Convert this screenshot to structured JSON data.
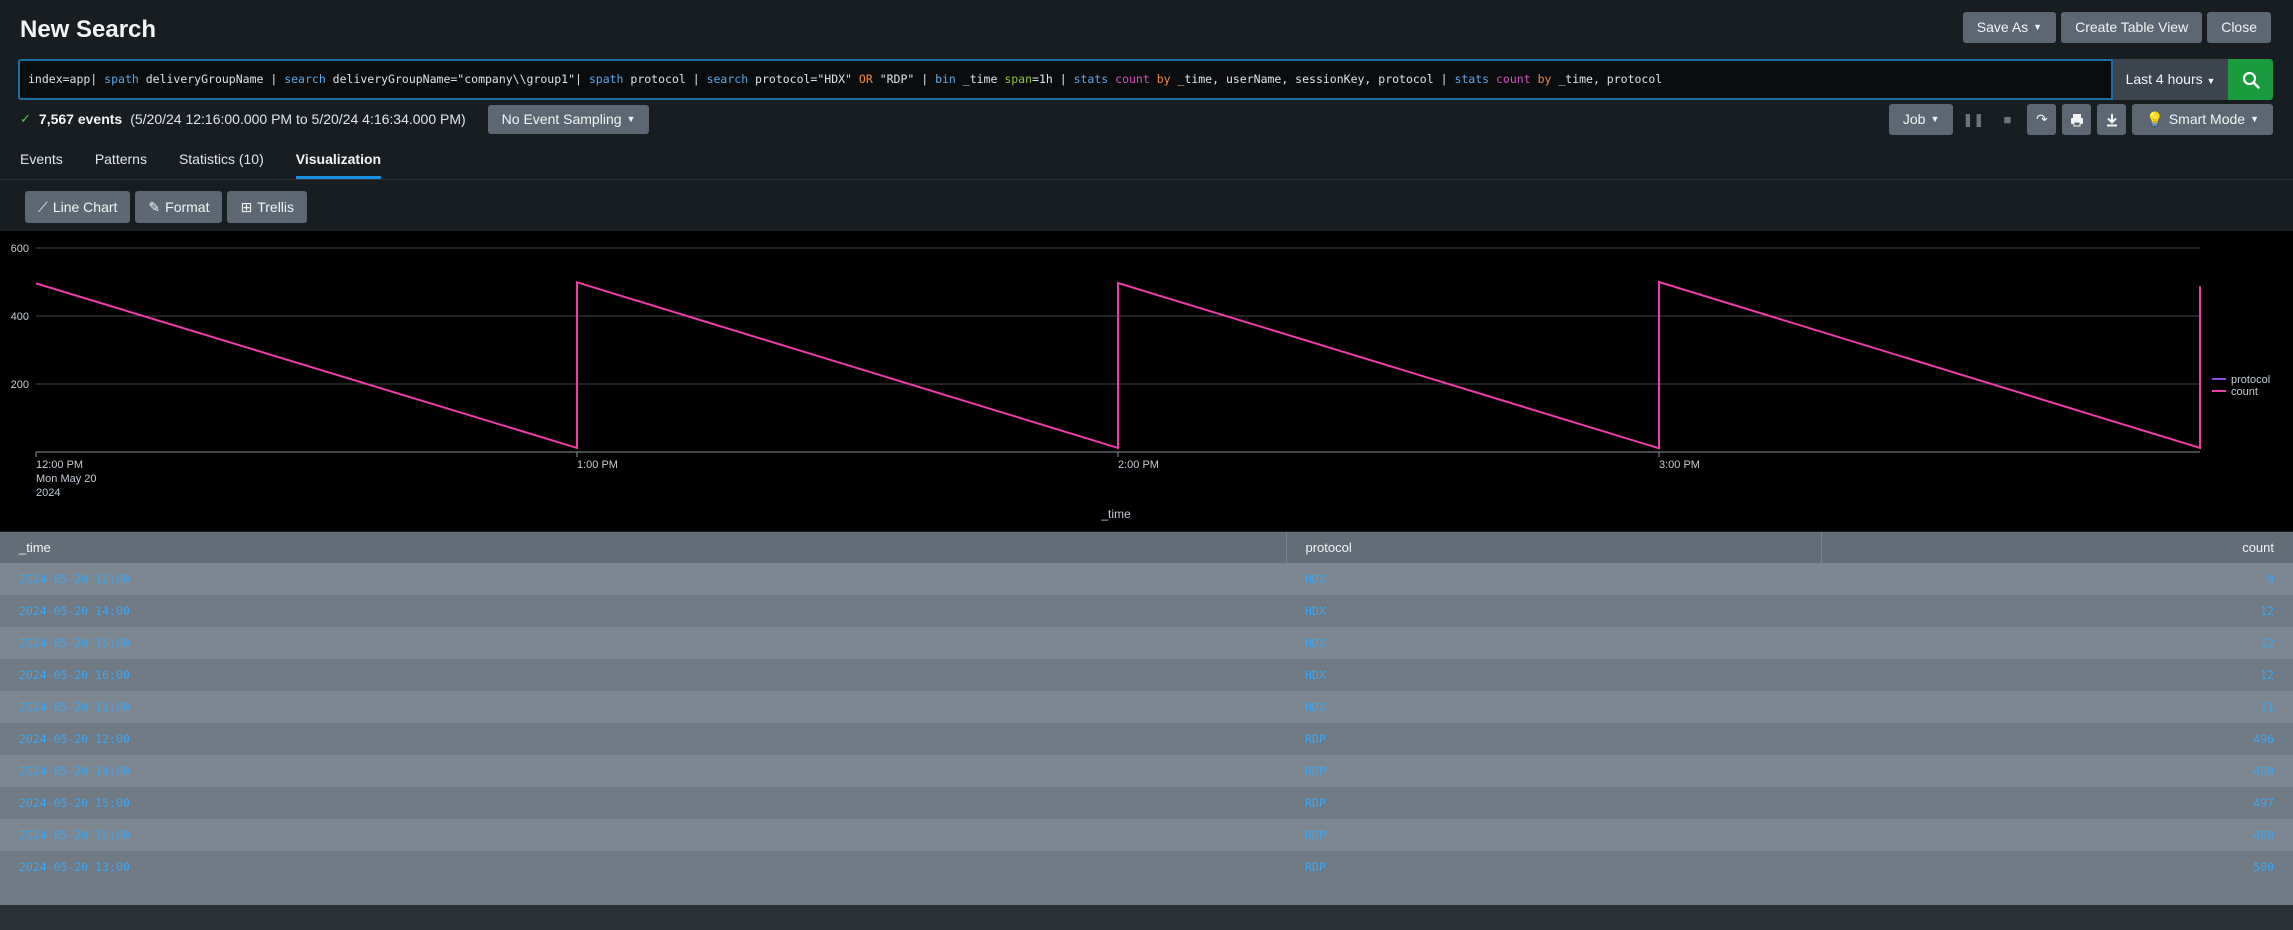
{
  "header": {
    "title": "New Search",
    "save_as": "Save As",
    "create_table_view": "Create Table View",
    "close": "Close"
  },
  "search": {
    "tokens": [
      {
        "t": "index=app| ",
        "c": ""
      },
      {
        "t": "spath",
        "c": "kw"
      },
      {
        "t": " deliveryGroupName | ",
        "c": ""
      },
      {
        "t": "search",
        "c": "kw"
      },
      {
        "t": " deliveryGroupName=\"company\\\\group1\"| ",
        "c": ""
      },
      {
        "t": "spath",
        "c": "kw"
      },
      {
        "t": " protocol | ",
        "c": ""
      },
      {
        "t": "search",
        "c": "kw"
      },
      {
        "t": " protocol=\"HDX\" ",
        "c": ""
      },
      {
        "t": "OR",
        "c": "op"
      },
      {
        "t": " \"RDP\" | ",
        "c": ""
      },
      {
        "t": "bin",
        "c": "kw"
      },
      {
        "t": " _time ",
        "c": ""
      },
      {
        "t": "span",
        "c": "arg"
      },
      {
        "t": "=1h | ",
        "c": ""
      },
      {
        "t": "stats",
        "c": "kw"
      },
      {
        "t": " ",
        "c": ""
      },
      {
        "t": "count",
        "c": "fn"
      },
      {
        "t": " ",
        "c": ""
      },
      {
        "t": "by",
        "c": "op"
      },
      {
        "t": " _time, userName, sessionKey, protocol | ",
        "c": ""
      },
      {
        "t": "stats",
        "c": "kw"
      },
      {
        "t": " ",
        "c": ""
      },
      {
        "t": "count",
        "c": "fn"
      },
      {
        "t": " ",
        "c": ""
      },
      {
        "t": "by",
        "c": "op"
      },
      {
        "t": " _time, protocol",
        "c": ""
      }
    ],
    "time_range": "Last 4 hours"
  },
  "status": {
    "events": "7,567 events",
    "range": "(5/20/24 12:16:00.000 PM to 5/20/24 4:16:34.000 PM)",
    "sampling": "No Event Sampling",
    "job": "Job",
    "mode": "Smart Mode"
  },
  "tabs": [
    {
      "label": "Events"
    },
    {
      "label": "Patterns"
    },
    {
      "label": "Statistics (10)"
    },
    {
      "label": "Visualization"
    }
  ],
  "viz_toolbar": {
    "line_chart": "Line Chart",
    "format": "Format",
    "trellis": "Trellis"
  },
  "chart_data": {
    "type": "line",
    "xlabel": "_time",
    "ylim": [
      0,
      600
    ],
    "y_ticks": [
      600,
      400,
      200
    ],
    "x_ticks": [
      "12:00 PM",
      "1:00 PM",
      "2:00 PM",
      "3:00 PM"
    ],
    "x_subtitle": [
      "Mon May 20",
      "2024"
    ],
    "grid": true,
    "legend_position": "right",
    "series": [
      {
        "name": "protocol",
        "color": "#8a4fd9",
        "x": [],
        "y": []
      },
      {
        "name": "count",
        "color": "#ee3ca8",
        "x": [
          0,
          1,
          1,
          2,
          2,
          3,
          3,
          4,
          4
        ],
        "y": [
          496,
          12,
          499,
          12,
          497,
          11,
          500,
          12,
          488
        ]
      }
    ]
  },
  "table": {
    "columns": [
      "_time",
      "protocol",
      "count"
    ],
    "rows": [
      [
        "2024-05-20 12:00",
        "HDX",
        "9"
      ],
      [
        "2024-05-20 14:00",
        "HDX",
        "12"
      ],
      [
        "2024-05-20 15:00",
        "HDX",
        "12"
      ],
      [
        "2024-05-20 16:00",
        "HDX",
        "12"
      ],
      [
        "2024-05-20 13:00",
        "HDX",
        "11"
      ],
      [
        "2024-05-20 12:00",
        "RDP",
        "496"
      ],
      [
        "2024-05-20 14:00",
        "RDP",
        "499"
      ],
      [
        "2024-05-20 15:00",
        "RDP",
        "497"
      ],
      [
        "2024-05-20 16:00",
        "RDP",
        "488"
      ],
      [
        "2024-05-20 13:00",
        "RDP",
        "500"
      ]
    ]
  }
}
